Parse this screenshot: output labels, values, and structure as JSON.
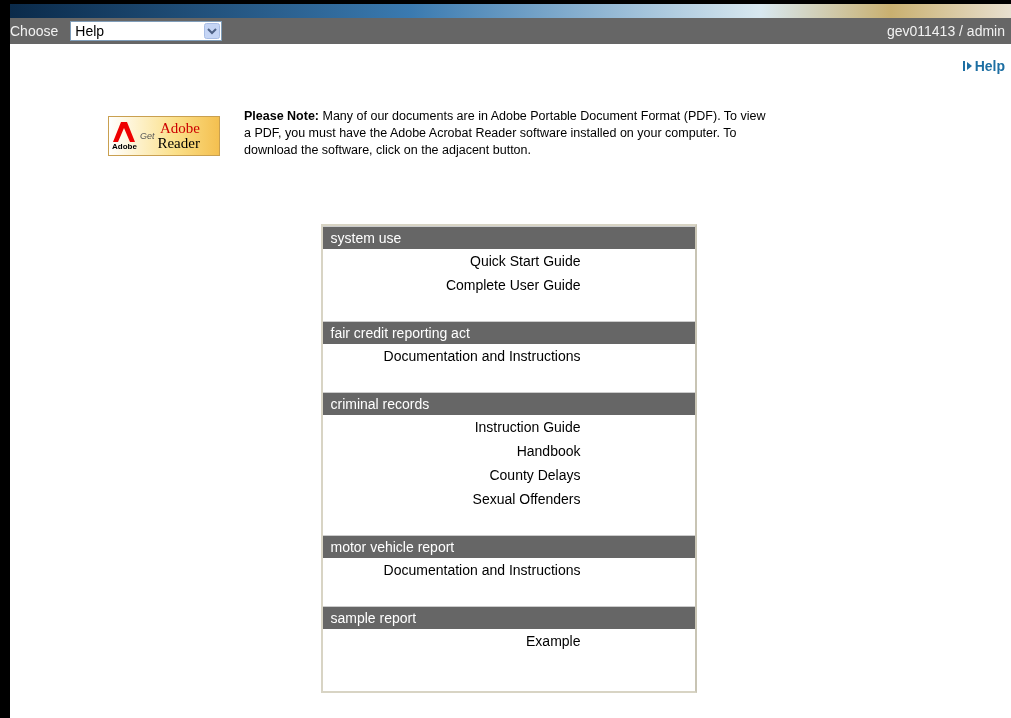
{
  "top_bar": {
    "label": "Choose",
    "select_value": "Help",
    "user": "gev011413 / admin"
  },
  "help_link": "Help",
  "adobe_badge": {
    "brand": "Adobe",
    "get": "Get",
    "product_top": "Adobe",
    "product_bottom": "Reader"
  },
  "note": "**Please Note:** Many of our documents are in Adobe Portable Document Format (PDF). To view a PDF, you must have the Adobe Acrobat Reader software installed on your computer. To download the software, click on the adjacent button.",
  "sections": [
    {
      "title": "system use",
      "links": [
        "Quick Start Guide",
        "Complete User Guide"
      ]
    },
    {
      "title": "fair credit reporting act",
      "links": [
        "Documentation and Instructions"
      ]
    },
    {
      "title": "criminal records",
      "links": [
        "Instruction Guide",
        "Handbook",
        "County Delays",
        "Sexual Offenders"
      ]
    },
    {
      "title": "motor vehicle report",
      "links": [
        "Documentation and Instructions"
      ]
    },
    {
      "title": "sample report",
      "links": [
        "Example"
      ]
    }
  ]
}
